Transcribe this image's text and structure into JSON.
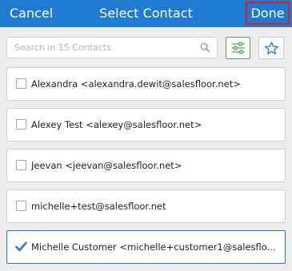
{
  "header": {
    "cancel_label": "Cancel",
    "title": "Select Contact",
    "done_label": "Done"
  },
  "search": {
    "placeholder": "Search in 15 Contacts",
    "value": ""
  },
  "toolbar": {
    "filter_icon": "sliders-icon",
    "favorite_icon": "star-icon"
  },
  "colors": {
    "header_bg": "#1f7ad1",
    "done_highlight": "#d9241d",
    "filter_accent": "#54a850",
    "check": "#1f7ad1"
  },
  "contacts": [
    {
      "label": "Alexandra <alexandra.dewit@salesfloor.net>",
      "selected": false
    },
    {
      "label": "Alexey Test <alexey@salesfloor.net>",
      "selected": false
    },
    {
      "label": "Jeevan <jeevan@salesfloor.net>",
      "selected": false
    },
    {
      "label": "michelle+test@salesfloor.net",
      "selected": false
    },
    {
      "label": "Michelle Customer <michelle+customer1@salesflo...",
      "selected": true
    }
  ]
}
